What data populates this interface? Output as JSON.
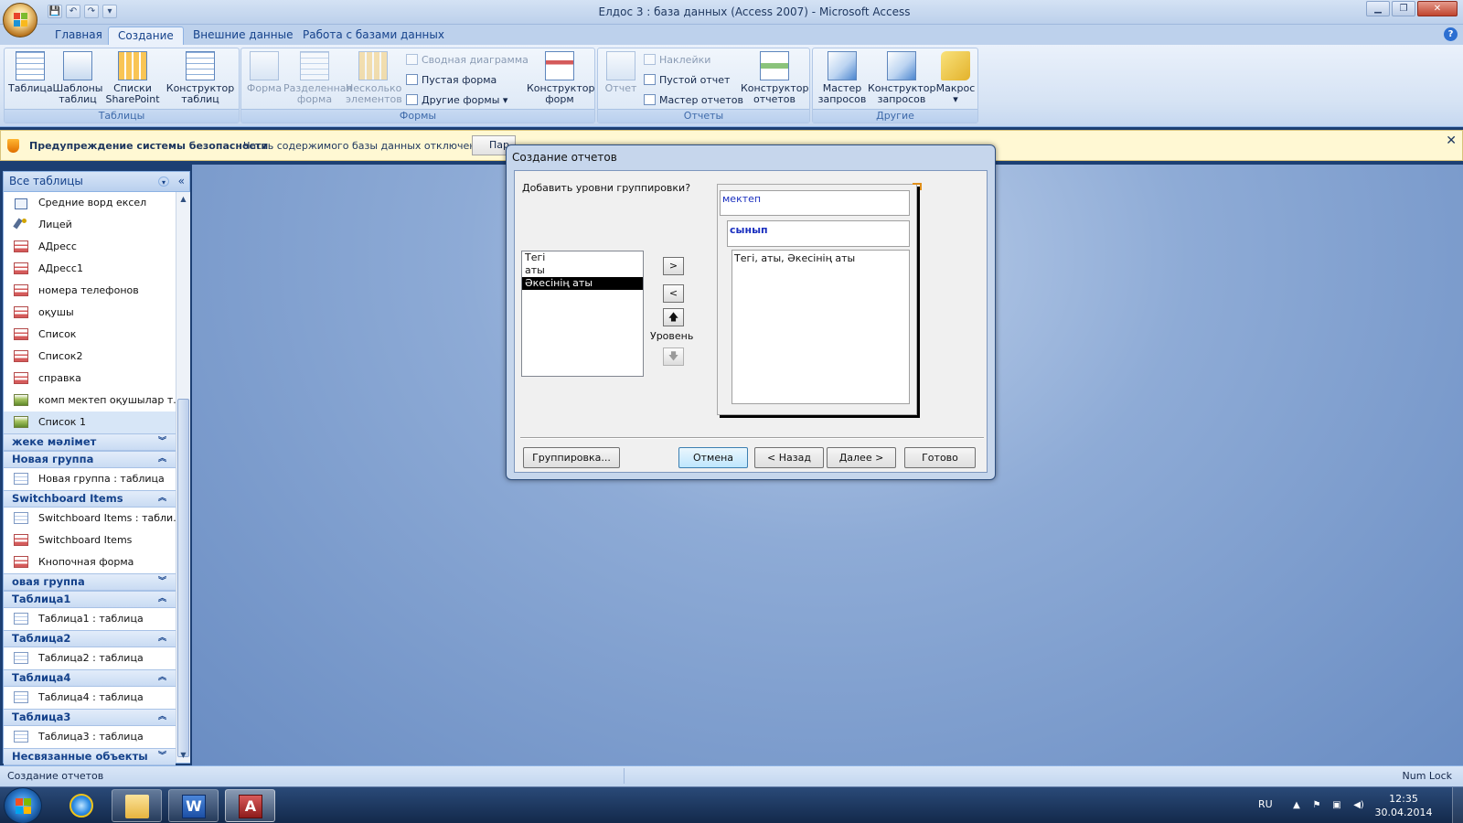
{
  "window": {
    "title": "Елдос 3 : база данных (Access 2007) - Microsoft Access",
    "min_glyph": "▁",
    "max_glyph": "❐",
    "close_glyph": "✕"
  },
  "qat": [
    "💾",
    "↶",
    "↷",
    "▾"
  ],
  "tabs": [
    {
      "label": "Главная",
      "active": false
    },
    {
      "label": "Создание",
      "active": true
    },
    {
      "label": "Внешние данные",
      "active": false
    },
    {
      "label": "Работа с базами данных",
      "active": false
    }
  ],
  "help_glyph": "?",
  "ribbon": {
    "groups": {
      "tables": "Таблицы",
      "forms": "Формы",
      "reports": "Отчеты",
      "other": "Другие"
    },
    "tables": {
      "table": "Таблица",
      "templates_l1": "Шаблоны",
      "templates_l2": "таблиц",
      "sharepoint_l1": "Списки",
      "sharepoint_l2": "SharePoint",
      "designer_l1": "Конструктор",
      "designer_l2": "таблиц"
    },
    "forms": {
      "form": "Форма",
      "split_l1": "Разделенная",
      "split_l2": "форма",
      "multi_l1": "Несколько",
      "multi_l2": "элементов",
      "pivot_chart": "Сводная диаграмма",
      "blank_form": "Пустая форма",
      "more_forms": "Другие формы",
      "designer_l1": "Конструктор",
      "designer_l2": "форм"
    },
    "reports": {
      "report": "Отчет",
      "labels": "Наклейки",
      "blank_report": "Пустой отчет",
      "report_wizard": "Мастер отчетов",
      "designer_l1": "Конструктор",
      "designer_l2": "отчетов"
    },
    "other": {
      "query_wizard_l1": "Мастер",
      "query_wizard_l2": "запросов",
      "query_designer_l1": "Конструктор",
      "query_designer_l2": "запросов",
      "macro": "Макрос"
    }
  },
  "security_bar": {
    "title": "Предупреждение системы безопасности",
    "text": "Часть содержимого базы данных отключено",
    "button": "Пар",
    "close": "✕"
  },
  "nav": {
    "header": "Все таблицы",
    "collapse": "«",
    "dropdown": "▾",
    "items_top": [
      {
        "label": "Средние ворд ексел",
        "icon": "link",
        "selected": false
      },
      {
        "label": "Лицей",
        "icon": "query",
        "selected": false
      },
      {
        "label": "АДресс",
        "icon": "form",
        "selected": false
      },
      {
        "label": "АДресс1",
        "icon": "form",
        "selected": false
      },
      {
        "label": "номера телефонов",
        "icon": "form",
        "selected": false
      },
      {
        "label": "оқушы",
        "icon": "form",
        "selected": false
      },
      {
        "label": "Список",
        "icon": "form",
        "selected": false
      },
      {
        "label": "Список2",
        "icon": "form",
        "selected": false
      },
      {
        "label": "справка",
        "icon": "form",
        "selected": false
      },
      {
        "label": "комп мектеп оқушылар т...",
        "icon": "macro",
        "selected": false
      },
      {
        "label": "Список 1",
        "icon": "macro",
        "selected": true
      }
    ],
    "groups": [
      {
        "name": "жеке мәлімет",
        "chevron": "︾",
        "items": []
      },
      {
        "name": "Новая группа",
        "chevron": "︽",
        "items": [
          {
            "label": "Новая группа : таблица",
            "icon": "table"
          }
        ]
      },
      {
        "name": "Switchboard Items",
        "chevron": "︽",
        "items": [
          {
            "label": "Switchboard Items : табли...",
            "icon": "table"
          },
          {
            "label": "Switchboard Items",
            "icon": "form"
          },
          {
            "label": "Кнопочная форма",
            "icon": "form"
          }
        ]
      },
      {
        "name": "овая группа",
        "chevron": "︾",
        "items": []
      },
      {
        "name": "Таблица1",
        "chevron": "︽",
        "items": [
          {
            "label": "Таблица1 : таблица",
            "icon": "table"
          }
        ]
      },
      {
        "name": "Таблица2",
        "chevron": "︽",
        "items": [
          {
            "label": "Таблица2 : таблица",
            "icon": "table"
          }
        ]
      },
      {
        "name": "Таблица4",
        "chevron": "︽",
        "items": [
          {
            "label": "Таблица4 : таблица",
            "icon": "table"
          }
        ]
      },
      {
        "name": "Таблица3",
        "chevron": "︽",
        "items": [
          {
            "label": "Таблица3 : таблица",
            "icon": "table"
          }
        ]
      },
      {
        "name": "Несвязанные объекты",
        "chevron": "︾",
        "items": []
      }
    ]
  },
  "dialog": {
    "title": "Создание отчетов",
    "question": "Добавить уровни группировки?",
    "fields": [
      {
        "label": "Тегі",
        "selected": false
      },
      {
        "label": "аты",
        "selected": false
      },
      {
        "label": "Әкесінің аты",
        "selected": true
      }
    ],
    "btn_add": ">",
    "btn_remove": "<",
    "btn_up": "🡅",
    "btn_down": "🡇",
    "level_label": "Уровень",
    "preview": {
      "level1": "мектеп",
      "level2": "сынып",
      "detail": "Тегі, аты, Әкесінің аты"
    },
    "grouping_btn": "Группировка...",
    "cancel_btn": "Отмена",
    "back_btn": "< Назад",
    "next_btn": "Далее >",
    "finish_btn": "Готово"
  },
  "status": {
    "left": "Создание отчетов",
    "right": "Num Lock"
  },
  "taskbar": {
    "lang": "RU",
    "time": "12:35",
    "date": "30.04.2014",
    "tray_up": "▲",
    "tray_flag": "⚑",
    "tray_net": "▣",
    "tray_vol": "◀)"
  }
}
